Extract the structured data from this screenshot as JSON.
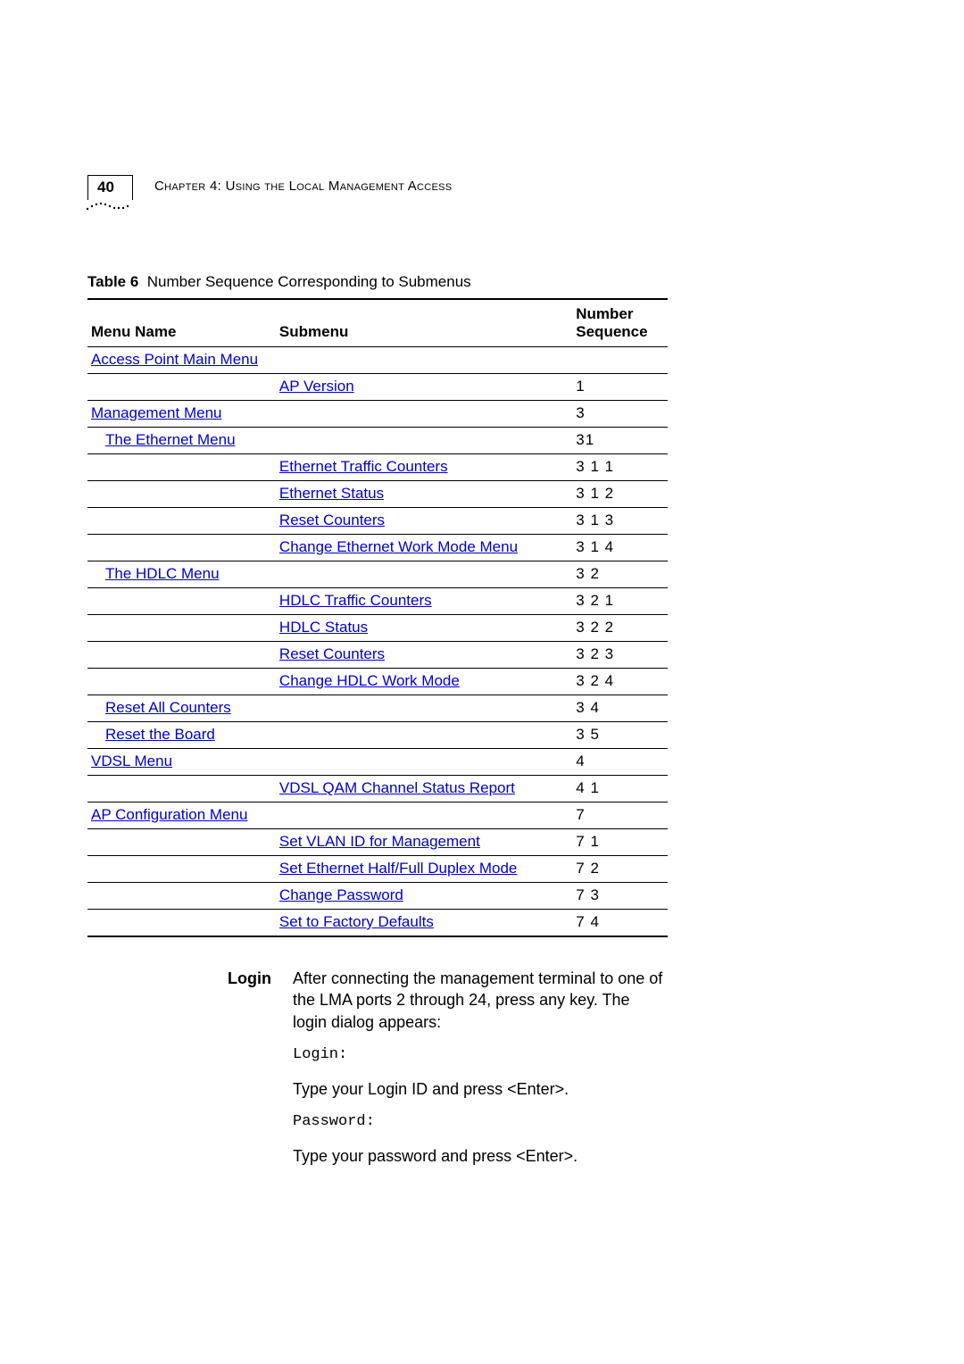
{
  "header": {
    "page_number": "40",
    "chapter_label": "Chapter 4: Using the Local Management Access"
  },
  "table_caption": {
    "label": "Table 6",
    "text": "Number Sequence Corresponding to Submenus"
  },
  "columns": {
    "c1": "Menu Name",
    "c2": "Submenu",
    "c3a": "Number",
    "c3b": "Sequence"
  },
  "rows": [
    {
      "menu": "Access Point Main Menu",
      "menu_indent": false,
      "submenu": "",
      "seq": ""
    },
    {
      "menu": "",
      "submenu": "AP Version",
      "seq": "1"
    },
    {
      "menu": "Management Menu",
      "menu_indent": false,
      "submenu": "",
      "seq": "3"
    },
    {
      "menu": "The Ethernet Menu",
      "menu_indent": true,
      "submenu": "",
      "seq": "31"
    },
    {
      "menu": "",
      "submenu": "Ethernet Traffic Counters",
      "seq": "3 1 1"
    },
    {
      "menu": "",
      "submenu": "Ethernet Status",
      "seq": "3 1 2"
    },
    {
      "menu": "",
      "submenu": "Reset Counters",
      "seq": "3 1 3"
    },
    {
      "menu": "",
      "submenu": "Change   Ethernet Work Mode Menu",
      "seq": "3 1 4"
    },
    {
      "menu": "The HDLC Menu",
      "menu_indent": true,
      "submenu": "",
      "seq": "3 2"
    },
    {
      "menu": "",
      "submenu": "HDLC Traffic Counters",
      "seq": "3 2 1"
    },
    {
      "menu": "",
      "submenu": "HDLC Status",
      "seq": "3 2 2"
    },
    {
      "menu": "",
      "submenu": "Reset Counters",
      "seq": "3 2 3"
    },
    {
      "menu": "",
      "submenu": "Change HDLC Work Mode",
      "seq": "3 2 4"
    },
    {
      "menu": "Reset All Counters",
      "menu_indent": true,
      "submenu": "",
      "seq": "3 4"
    },
    {
      "menu": "Reset the Board",
      "menu_indent": true,
      "submenu": "",
      "seq": "3 5"
    },
    {
      "menu": "VDSL Menu",
      "menu_indent": false,
      "submenu": "",
      "seq": "4"
    },
    {
      "menu": "",
      "submenu": "VDSL QAM Channel Status Report",
      "seq": "4 1"
    },
    {
      "menu": "AP Configuration Menu",
      "menu_indent": false,
      "submenu": "",
      "seq": "7"
    },
    {
      "menu": "",
      "submenu": "Set VLAN ID for Management",
      "seq": "7 1"
    },
    {
      "menu": "",
      "submenu": "Set Ethernet Half/Full Duplex Mode",
      "seq": "7 2"
    },
    {
      "menu": "",
      "submenu": "Change Password",
      "seq": "7 3"
    },
    {
      "menu": "",
      "submenu": "Set to Factory Defaults",
      "seq": "7 4"
    }
  ],
  "body": {
    "label": "Login",
    "p1": "After connecting the management terminal to one of the LMA ports 2 through 24, press any key. The login dialog appears:",
    "code1": "Login:",
    "p2": "Type your Login ID and press <Enter>.",
    "code2": "Password:",
    "p3": "Type your password and press <Enter>."
  }
}
